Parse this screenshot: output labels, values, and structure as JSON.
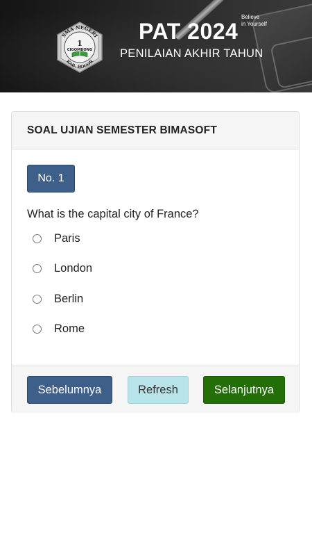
{
  "banner": {
    "title": "PAT 2024",
    "tagline": "Believe\nin Yourself",
    "subtitle": "PENILAIAN AKHIR TAHUN",
    "logo": {
      "top_text": "SMA NEGERI",
      "number": "1",
      "name": "CIGOMBONG",
      "bottom_text": "KAB. BOGOR"
    }
  },
  "exam": {
    "header_title": "SOAL UJIAN SEMESTER BIMASOFT",
    "question_number_label": "No. 1",
    "question_text": "What is the capital city of France?",
    "options": [
      {
        "label": "Paris",
        "selected": false
      },
      {
        "label": "London",
        "selected": false
      },
      {
        "label": "Berlin",
        "selected": false
      },
      {
        "label": "Rome",
        "selected": false
      }
    ]
  },
  "footer": {
    "prev_label": "Sebelumnya",
    "refresh_label": "Refresh",
    "next_label": "Selanjutnya"
  },
  "colors": {
    "primary": "#3e5f8a",
    "info": "#b8e3e8",
    "success": "#246e09",
    "banner_bg": "#1f1f1f"
  },
  "icons": {
    "logo": "school-emblem-icon",
    "radio": "radio-unchecked-icon"
  }
}
